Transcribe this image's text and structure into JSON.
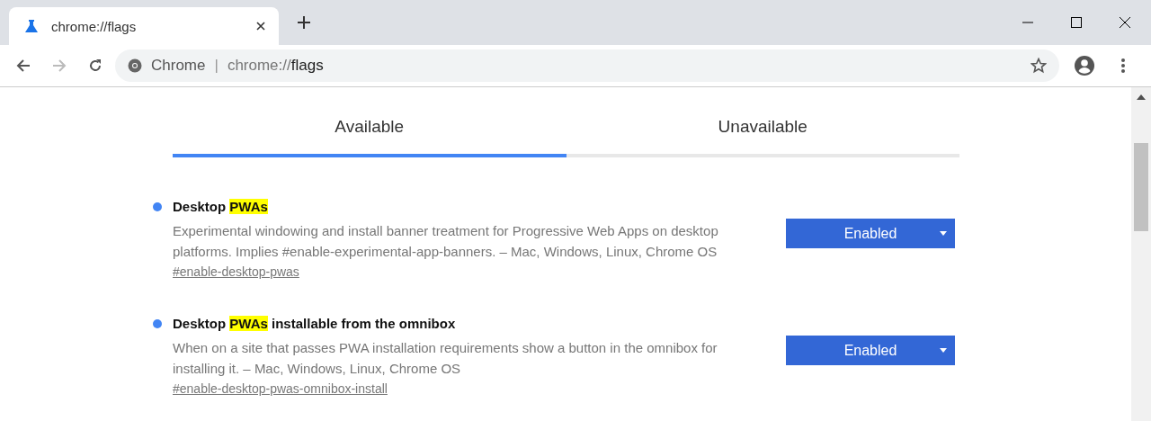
{
  "window": {
    "tab_title": "chrome://flags"
  },
  "omnibox": {
    "site": "Chrome",
    "separator": "|",
    "url_scheme": "chrome://",
    "url_path": "flags"
  },
  "tabs": [
    {
      "label": "Available",
      "selected": true
    },
    {
      "label": "Unavailable",
      "selected": false
    }
  ],
  "flags": [
    {
      "title": [
        {
          "text": "Desktop ",
          "highlighted": false
        },
        {
          "text": "PWAs",
          "highlighted": true
        }
      ],
      "description": "Experimental windowing and install banner treatment for Progressive Web Apps on desktop platforms. Implies #enable-experimental-app-banners. – Mac, Windows, Linux, Chrome OS",
      "link": "#enable-desktop-pwas",
      "value": "Enabled"
    },
    {
      "title": [
        {
          "text": "Desktop ",
          "highlighted": false
        },
        {
          "text": "PWAs",
          "highlighted": true
        },
        {
          "text": " installable from the omnibox",
          "highlighted": false
        }
      ],
      "description": "When on a site that passes PWA installation requirements show a button in the omnibox for installing it. – Mac, Windows, Linux, Chrome OS",
      "link": "#enable-desktop-pwas-omnibox-install",
      "value": "Enabled"
    }
  ]
}
